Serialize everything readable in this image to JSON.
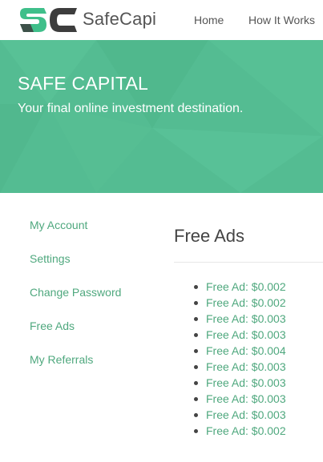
{
  "colors": {
    "accent": "#54bc92",
    "link": "#4fa87e",
    "logo_green": "#3fbf8a",
    "logo_dark": "#3d3d3d"
  },
  "navbar": {
    "logo_icon": "sc-logo-icon",
    "brand": "SafeCapi",
    "links": [
      "Home",
      "How It Works"
    ]
  },
  "hero": {
    "title": "SAFE CAPITAL",
    "subtitle": "Your final online investment destination."
  },
  "sidebar": {
    "items": [
      "My Account",
      "Settings",
      "Change Password",
      "Free Ads",
      "My Referrals"
    ]
  },
  "main": {
    "title": "Free Ads",
    "ads": [
      "Free Ad: $0.002",
      "Free Ad: $0.002",
      "Free Ad: $0.003",
      "Free Ad: $0.003",
      "Free Ad: $0.004",
      "Free Ad: $0.003",
      "Free Ad: $0.003",
      "Free Ad: $0.003",
      "Free Ad: $0.003",
      "Free Ad: $0.002"
    ]
  }
}
